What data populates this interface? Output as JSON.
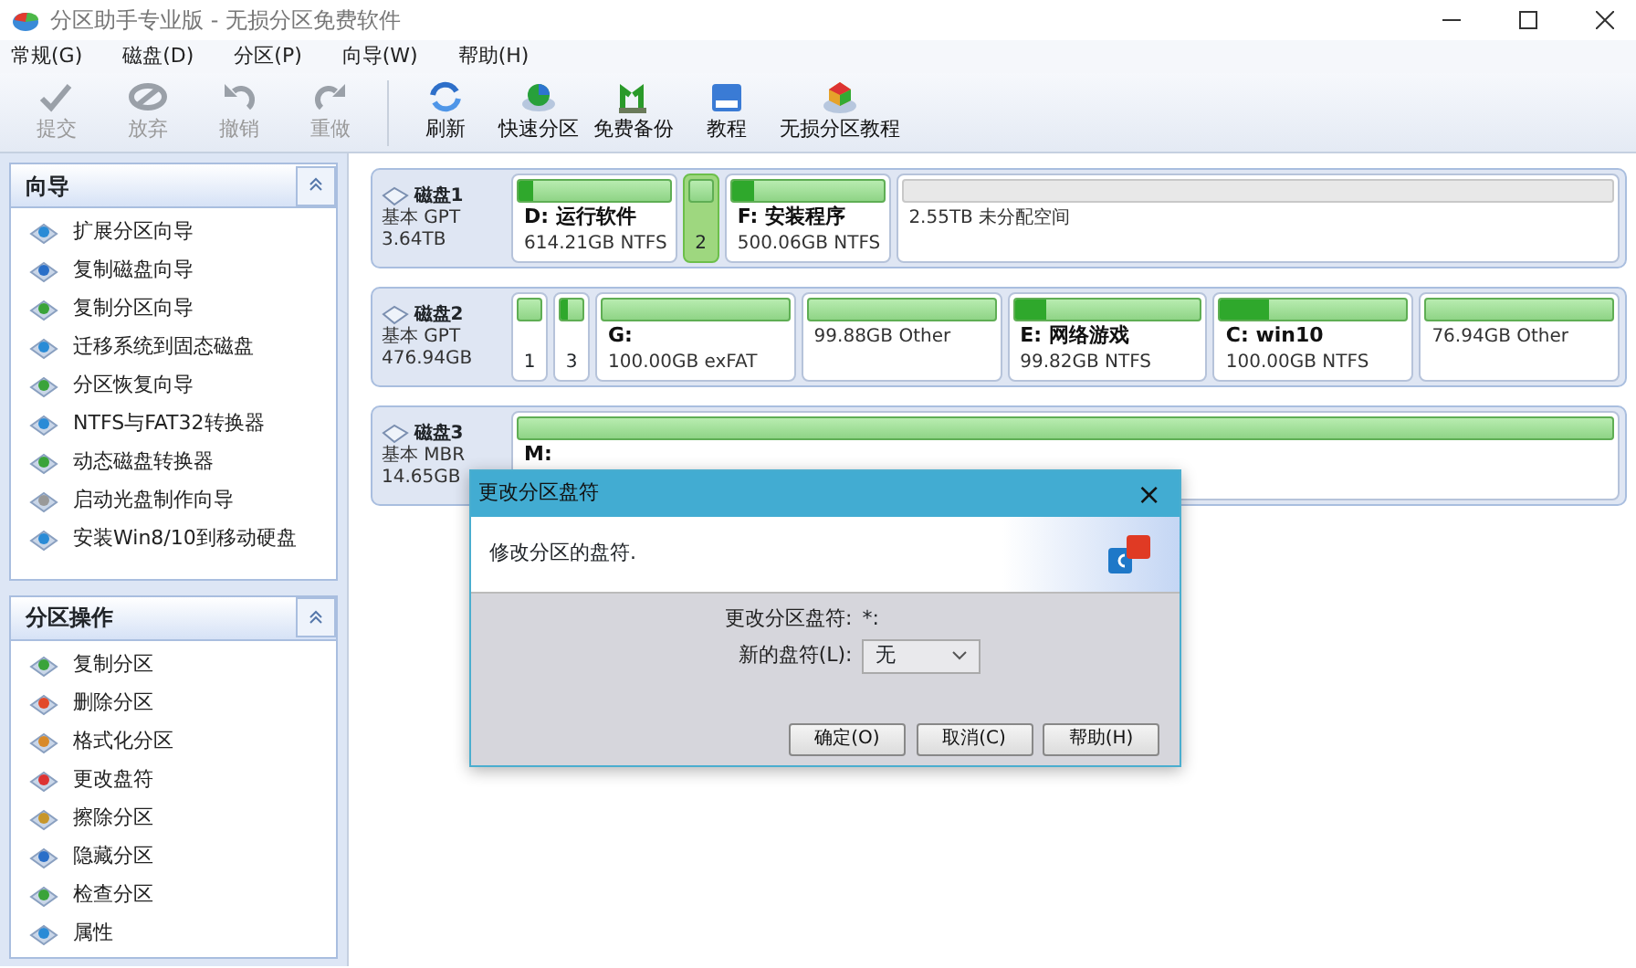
{
  "window": {
    "title": "分区助手专业版 - 无损分区免费软件"
  },
  "menu": [
    "常规(G)",
    "磁盘(D)",
    "分区(P)",
    "向导(W)",
    "帮助(H)"
  ],
  "toolbar": [
    {
      "label": "提交",
      "disabled": true
    },
    {
      "label": "放弃",
      "disabled": true
    },
    {
      "label": "撤销",
      "disabled": true
    },
    {
      "label": "重做",
      "disabled": true
    },
    {
      "label": "刷新",
      "disabled": false
    },
    {
      "label": "快速分区",
      "disabled": false
    },
    {
      "label": "免费备份",
      "disabled": false
    },
    {
      "label": "教程",
      "disabled": false
    },
    {
      "label": "无损分区教程",
      "disabled": false
    }
  ],
  "sidebar": [
    {
      "title": "向导",
      "expanded": true,
      "items": [
        "扩展分区向导",
        "复制磁盘向导",
        "复制分区向导",
        "迁移系统到固态磁盘",
        "分区恢复向导",
        "NTFS与FAT32转换器",
        "动态磁盘转换器",
        "启动光盘制作向导",
        "安装Win8/10到移动硬盘"
      ]
    },
    {
      "title": "分区操作",
      "expanded": true,
      "items": [
        "复制分区",
        "删除分区",
        "格式化分区",
        "更改盘符",
        "擦除分区",
        "隐藏分区",
        "检查分区",
        "属性"
      ]
    }
  ],
  "disks": [
    {
      "name": "磁盘1",
      "type": "基本 GPT",
      "size": "3.64TB",
      "partitions": [
        {
          "kind": "partition",
          "label": "D: 运行软件",
          "info": "614.21GB NTFS",
          "level": 0.1,
          "selected": false
        },
        {
          "kind": "narrow",
          "label": "2",
          "selected": true
        },
        {
          "kind": "partition",
          "label": "F: 安装程序",
          "info": "500.06GB NTFS",
          "level": 0.15,
          "selected": false
        },
        {
          "kind": "unallocated",
          "info": "2.55TB 未分配空间",
          "selected": false
        }
      ]
    },
    {
      "name": "磁盘2",
      "type": "基本 GPT",
      "size": "476.94GB",
      "partitions": [
        {
          "kind": "narrow",
          "label": "1",
          "selected": false
        },
        {
          "kind": "narrow",
          "label": "3",
          "level": 0.3,
          "selected": false
        },
        {
          "kind": "partition",
          "label": "G:",
          "info": "100.00GB exFAT",
          "selected": false
        },
        {
          "kind": "partition",
          "info": "99.88GB Other",
          "selected": false
        },
        {
          "kind": "partition",
          "label": "E: 网络游戏",
          "info": "99.82GB NTFS",
          "level": 0.17,
          "selected": false
        },
        {
          "kind": "partition",
          "label": "C: win10",
          "info": "100.00GB NTFS",
          "level": 0.26,
          "selected": false
        },
        {
          "kind": "partition",
          "info": "76.94GB Other",
          "selected": false
        }
      ]
    },
    {
      "name": "磁盘3",
      "type": "基本 MBR",
      "size": "14.65GB",
      "partitions": [
        {
          "kind": "partition",
          "label": "M:",
          "selected": false
        }
      ]
    }
  ],
  "dialog": {
    "title": "更改分区盘符",
    "close": "×",
    "description": "修改分区的盘符.",
    "fields": [
      {
        "label": "更改分区盘符:",
        "value": "*:",
        "kind": "text"
      },
      {
        "label": "新的盘符(L):",
        "value": "无",
        "kind": "select"
      }
    ],
    "buttons": [
      "确定(O)",
      "取消(C)",
      "帮助(H)"
    ]
  }
}
